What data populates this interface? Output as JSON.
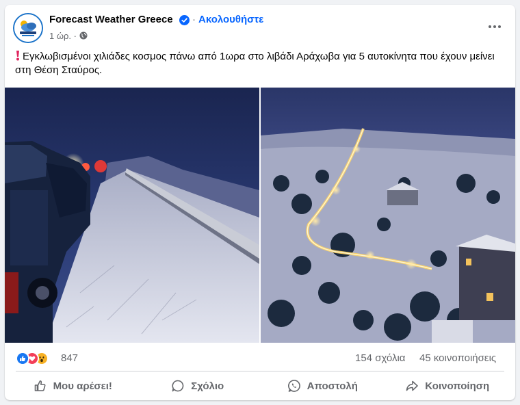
{
  "post": {
    "page_name": "Forecast Weather Greece",
    "separator": "·",
    "follow_label": "Ακολουθήστε",
    "timestamp": "1 ώρ. ·",
    "body_text": "Εγκλωβισμένοι χιλιάδες κοσμος πάνω από 1ωρα  στο λιβάδι Αράχωβα για 5 αυτοκίνητα που έχουν μείνει στη Θέση Σταύρος."
  },
  "icons": {
    "avatar": "weather-logo-icon",
    "verified": "verified-badge-icon",
    "privacy": "globe-icon",
    "more": "more-options-icon",
    "exclaim": "red-exclamation-icon"
  },
  "stats": {
    "reaction_count": "847",
    "reactions": [
      "like",
      "love",
      "wow"
    ],
    "comments": "154 σχόλια",
    "shares": "45 κοινοποιήσεις"
  },
  "actions": {
    "like": "Μου αρέσει!",
    "comment": "Σχόλιο",
    "send": "Αποστολή",
    "share": "Κοινοποίηση"
  },
  "colors": {
    "accent": "#0866ff",
    "secondary_text": "#65676b",
    "like_blue": "#1877f2",
    "love_red": "#f33e58",
    "wow_yellow": "#f7b125"
  }
}
